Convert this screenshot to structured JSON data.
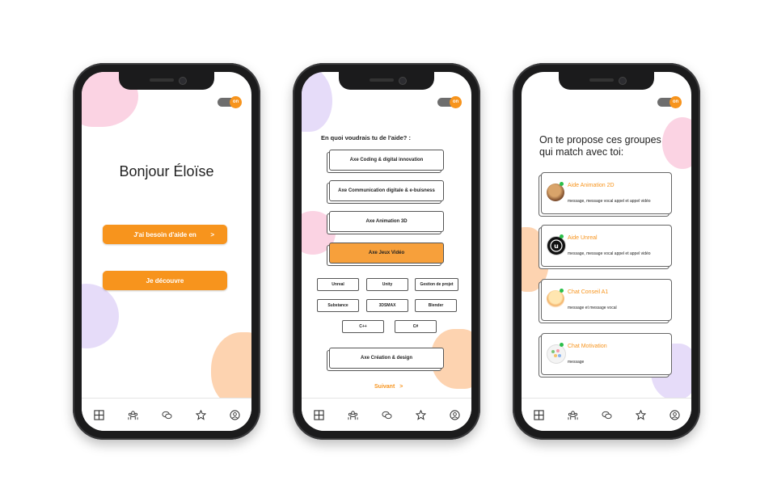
{
  "phones": {
    "p1": {
      "toggle": "on",
      "greeting": "Bonjour Éloïse",
      "btn_help": "J'ai besoin d'aide en",
      "btn_help_arrow": ">",
      "btn_discover": "Je découvre"
    },
    "p2": {
      "toggle": "on",
      "question": "En quoi voudrais tu de l'aide? :",
      "axes": [
        "Axe Coding & digital innovation",
        "Axe Communication digitale & e-buisness",
        "Axe Animation 3D",
        "Axe Jeux Vidéo",
        "Axe Création & design"
      ],
      "chips": [
        "Unreal",
        "Unity",
        "Gestion de projet",
        "Substance",
        "3DSMAX",
        "Blender",
        "C++",
        "C#"
      ],
      "next": "Suivant",
      "next_arrow": ">"
    },
    "p3": {
      "toggle": "on",
      "title_line1": "On te propose ces groupes",
      "title_line2": "qui match avec toi:",
      "groups": [
        {
          "name": "Aide Animation 2D",
          "desc": "message, message vocal appel et appel vidéo"
        },
        {
          "name": "Aide Unreal",
          "desc": "message, message vocal appel et appel vidéo"
        },
        {
          "name": "Chat Conseil A1",
          "desc": "message et message vocal"
        },
        {
          "name": "Chat Motivation",
          "desc": "message"
        }
      ]
    }
  },
  "nav_icons": [
    "grid-icon",
    "community-icon",
    "chat-icon",
    "star-icon",
    "profile-icon"
  ],
  "colors": {
    "accent": "#f7941d",
    "pink": "#fbd3e3",
    "lavender": "#e6dcf9",
    "peach": "#fdd3b0",
    "online": "#2bbf4a"
  }
}
